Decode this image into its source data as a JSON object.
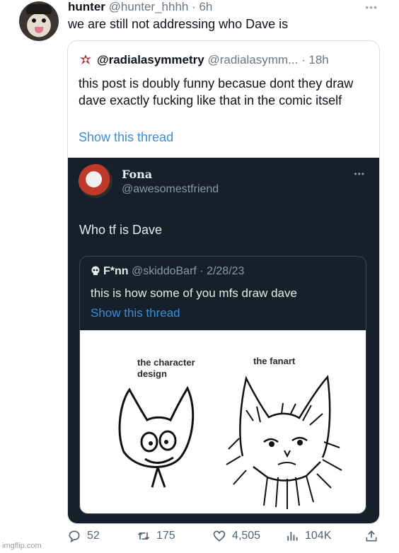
{
  "tweet": {
    "name": "hunter",
    "handle": "@hunter_hhhh",
    "separator": " · ",
    "time": "6h",
    "text": "we are still not addressing who Dave is",
    "more": "•••"
  },
  "quoted": {
    "name": "@radialasymmetry",
    "handle": "@radialasymm...",
    "separator": " · ",
    "time": "18h",
    "text": "this post is doubly funny becasue dont they draw dave exactly fucking like that in the comic itself",
    "show_thread": "Show this thread"
  },
  "screenshot": {
    "name": "Fona",
    "handle": "@awesomestfriend",
    "more": "•••",
    "text": "Who tf is Dave",
    "inner": {
      "name": "F*nn",
      "handle": "@skiddoBarf",
      "separator": " · ",
      "date": "2/28/23",
      "text": "this is how some of you mfs draw dave",
      "show_thread": "Show this thread"
    },
    "art": {
      "label_left_1": "the character",
      "label_left_2": "design",
      "label_right": "the fanart"
    }
  },
  "actions": {
    "replies": "52",
    "retweets": "175",
    "likes": "4,505",
    "views": "104K"
  },
  "watermark": "imgflip.com",
  "colors": {
    "link": "#3a8fd8",
    "dark_bg": "#15202b",
    "muted": "#6b7680"
  }
}
